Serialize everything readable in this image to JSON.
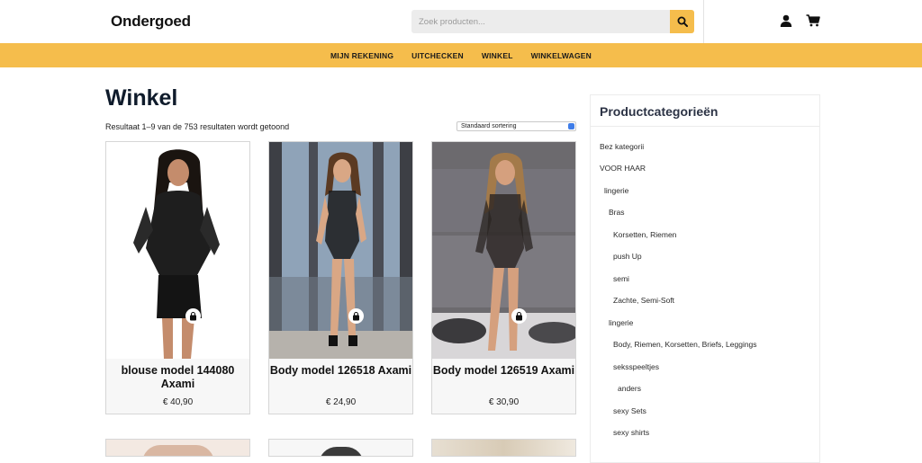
{
  "header": {
    "logo": "Ondergoed",
    "search_placeholder": "Zoek producten...",
    "icons": [
      "search-icon",
      "user-icon",
      "cart-icon"
    ]
  },
  "nav": {
    "items": [
      "MIJN REKENING",
      "UITCHECKEN",
      "WINKEL",
      "WINKELWAGEN"
    ]
  },
  "main": {
    "title": "Winkel",
    "result_count": "Resultaat 1–9 van de 753 resultaten wordt getoond",
    "sort_selected": "Standaard sortering"
  },
  "products": [
    {
      "title": "blouse model 144080 Axami",
      "price": "€ 40,90"
    },
    {
      "title": "Body model 126518 Axami",
      "price": "€ 24,90"
    },
    {
      "title": "Body model 126519 Axami",
      "price": "€ 30,90"
    }
  ],
  "sidebar": {
    "title": "Productcategorieën",
    "categories": [
      "Bez kategorii",
      "VOOR HAAR",
      "lingerie",
      "Bras",
      "Korsetten, Riemen",
      "push Up",
      "semi",
      "Zachte, Semi-Soft",
      "lingerie",
      "Body, Riemen, Korsetten, Briefs, Leggings",
      "seksspeeltjes",
      "anders",
      "sexy Sets",
      "sexy shirts"
    ]
  },
  "colors": {
    "accent": "#f5bd4c",
    "title": "#0f1b2b",
    "sidebar_title": "#2c3345"
  }
}
